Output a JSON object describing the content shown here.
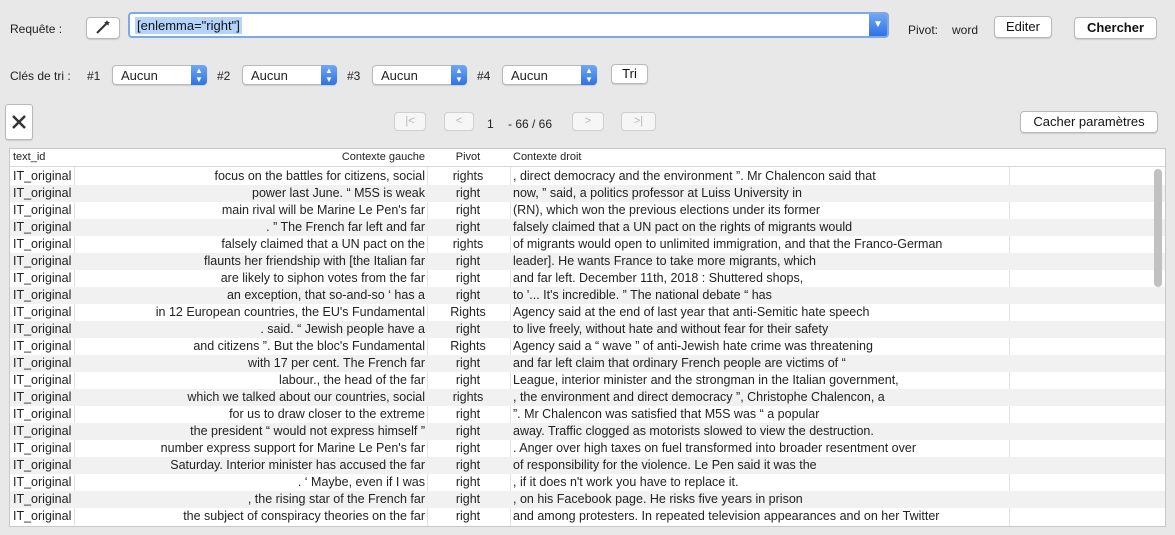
{
  "top": {
    "query_label": "Requête :",
    "query_value": "[enlemma=\"right\"]",
    "pivot_label": "Pivot:",
    "pivot_value": "word",
    "edit_label": "Editer",
    "search_label": "Chercher"
  },
  "sort": {
    "label": "Clés de tri :",
    "keys": [
      {
        "tag": "#1",
        "value": "Aucun"
      },
      {
        "tag": "#2",
        "value": "Aucun"
      },
      {
        "tag": "#3",
        "value": "Aucun"
      },
      {
        "tag": "#4",
        "value": "Aucun"
      }
    ],
    "sort_button": "Tri"
  },
  "nav": {
    "first": "|<",
    "prev": "<",
    "page": "1",
    "range": "- 66 / 66",
    "next": ">",
    "last": ">|",
    "hide_params": "Cacher paramètres"
  },
  "table": {
    "headers": {
      "id": "text_id",
      "left": "Contexte gauche",
      "pivot": "Pivot",
      "right": "Contexte droit"
    },
    "rows": [
      {
        "id": "IT_original",
        "left": "focus on the battles for citizens, social",
        "pivot": "rights",
        "right": ", direct democracy and the environment ”. Mr Chalencon said that"
      },
      {
        "id": "IT_original",
        "left": "power last June. “ M5S is weak",
        "pivot": "right",
        "right": "now, ” said, a politics professor at Luiss University in"
      },
      {
        "id": "IT_original",
        "left": "main rival will be Marine Le Pen's far",
        "pivot": "right",
        "right": "(RN), which won the previous elections under its former"
      },
      {
        "id": "IT_original",
        "left": ". ” The French far left and far",
        "pivot": "right",
        "right": "falsely claimed that a UN pact on the rights of migrants would"
      },
      {
        "id": "IT_original",
        "left": "falsely claimed that a UN pact on the",
        "pivot": "rights",
        "right": "of migrants would open to unlimited immigration, and that the Franco-German"
      },
      {
        "id": "IT_original",
        "left": "flaunts her friendship with [the Italian far",
        "pivot": "right",
        "right": "leader]. He wants France to take more migrants, which"
      },
      {
        "id": "IT_original",
        "left": "are likely to siphon votes from the far",
        "pivot": "right",
        "right": "and far left. December 11th, 2018 : Shuttered shops,"
      },
      {
        "id": "IT_original",
        "left": "an exception, that so-and-so ‘ has a",
        "pivot": "right",
        "right": "to '... It's incredible. ” The national debate “ has"
      },
      {
        "id": "IT_original",
        "left": "in 12 European countries, the EU's Fundamental",
        "pivot": "Rights",
        "right": "Agency said at the end of last year that anti-Semitic hate speech"
      },
      {
        "id": "IT_original",
        "left": ". said. “ Jewish people have a",
        "pivot": "right",
        "right": "to live freely, without hate and without fear for their safety"
      },
      {
        "id": "IT_original",
        "left": "and citizens ”. But the bloc's Fundamental",
        "pivot": "Rights",
        "right": "Agency said a “ wave ” of anti-Jewish hate crime was threatening"
      },
      {
        "id": "IT_original",
        "left": "with 17 per cent. The French far",
        "pivot": "right",
        "right": "and far left claim that ordinary French people are victims of “"
      },
      {
        "id": "IT_original",
        "left": "labour., the head of the far",
        "pivot": "right",
        "right": "League, interior minister and the strongman in the Italian government,"
      },
      {
        "id": "IT_original",
        "left": "which we talked about our countries, social",
        "pivot": "rights",
        "right": ", the environment and direct democracy ”, Christophe Chalencon, a"
      },
      {
        "id": "IT_original",
        "left": "for us to draw closer to the extreme",
        "pivot": "right",
        "right": "”. Mr Chalencon was satisfied that M5S was “ a popular"
      },
      {
        "id": "IT_original",
        "left": "the president “ would not express himself ”",
        "pivot": "right",
        "right": "away. Traffic clogged as motorists slowed to view the destruction."
      },
      {
        "id": "IT_original",
        "left": "number express support for Marine Le Pen's far",
        "pivot": "right",
        "right": ". Anger over high taxes on fuel transformed into broader resentment over"
      },
      {
        "id": "IT_original",
        "left": "Saturday. Interior minister has accused the far",
        "pivot": "right",
        "right": "of responsibility for the violence. Le Pen said it was the"
      },
      {
        "id": "IT_original",
        "left": ". ‘ Maybe, even if I was",
        "pivot": "right",
        "right": ", if it does n't work you have to replace it."
      },
      {
        "id": "IT_original",
        "left": ", the rising star of the French far",
        "pivot": "right",
        "right": ", on his Facebook page. He risks five years in prison"
      },
      {
        "id": "IT_original",
        "left": "the subject of conspiracy theories on the far",
        "pivot": "right",
        "right": "and among protesters. In repeated television appearances and on her Twitter"
      }
    ]
  }
}
